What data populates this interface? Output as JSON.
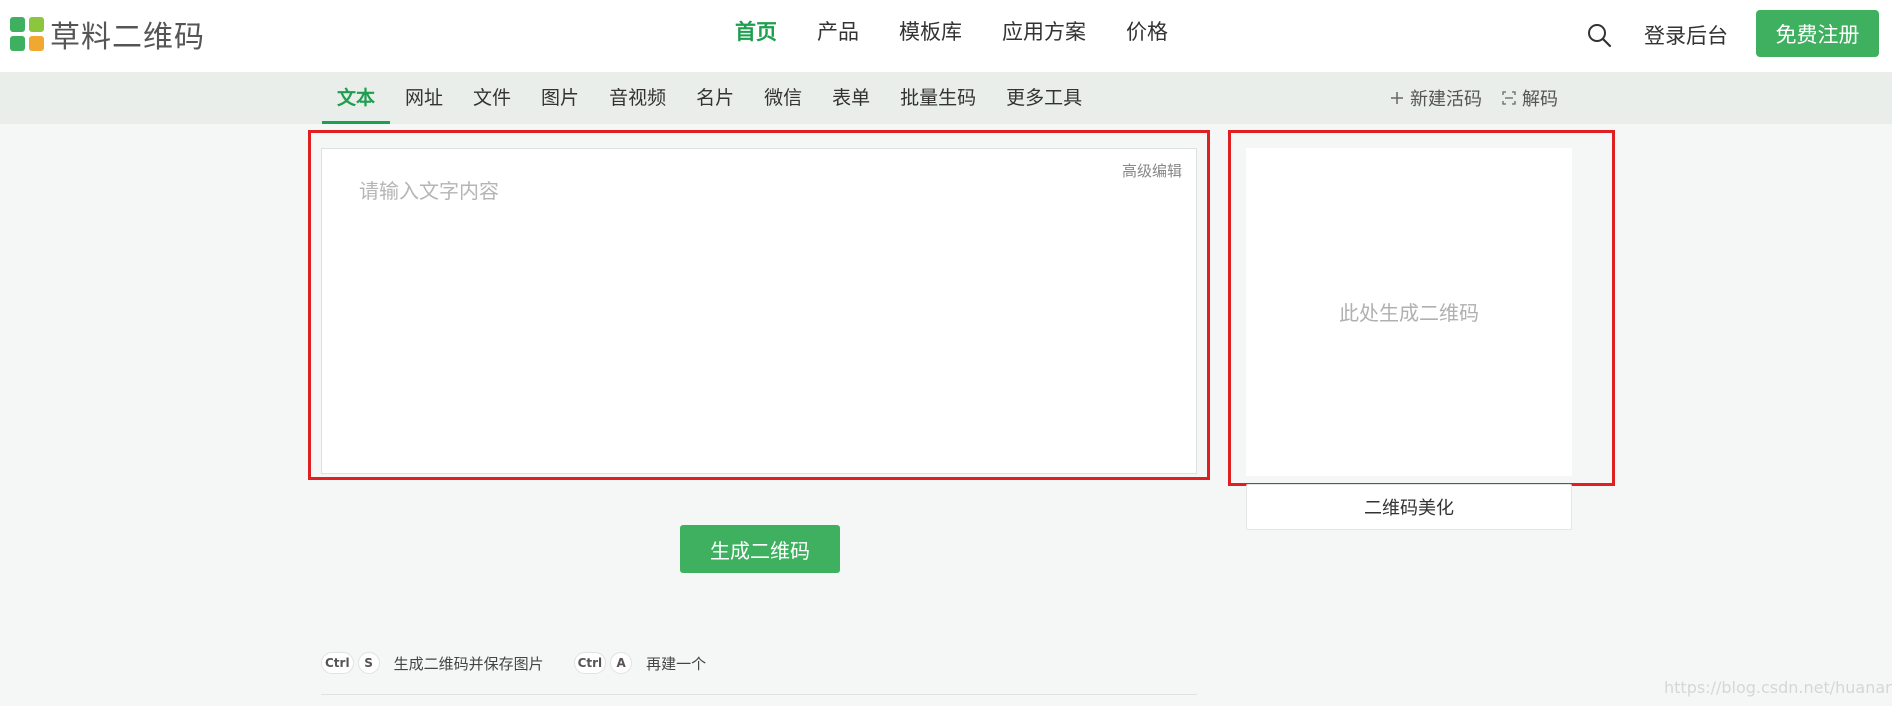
{
  "header": {
    "logo_text": "草料二维码",
    "nav": [
      {
        "label": "首页",
        "active": true
      },
      {
        "label": "产品",
        "active": false
      },
      {
        "label": "模板库",
        "active": false
      },
      {
        "label": "应用方案",
        "active": false
      },
      {
        "label": "价格",
        "active": false
      }
    ],
    "search_icon": "search-icon",
    "login_label": "登录后台",
    "register_label": "免费注册"
  },
  "subnav": {
    "tabs": [
      {
        "label": "文本",
        "active": true
      },
      {
        "label": "网址",
        "active": false
      },
      {
        "label": "文件",
        "active": false
      },
      {
        "label": "图片",
        "active": false
      },
      {
        "label": "音视频",
        "active": false
      },
      {
        "label": "名片",
        "active": false
      },
      {
        "label": "微信",
        "active": false
      },
      {
        "label": "表单",
        "active": false
      },
      {
        "label": "批量生码",
        "active": false
      },
      {
        "label": "更多工具",
        "active": false
      }
    ],
    "new_live_code_label": "新建活码",
    "decode_label": "解码"
  },
  "editor": {
    "placeholder": "请输入文字内容",
    "advanced_label": "高级编辑"
  },
  "qr_panel": {
    "placeholder_text": "此处生成二维码",
    "beautify_label": "二维码美化"
  },
  "generate_label": "生成二维码",
  "shortcuts": [
    {
      "keys": [
        "Ctrl",
        "S"
      ],
      "label": "生成二维码并保存图片"
    },
    {
      "keys": [
        "Ctrl",
        "A"
      ],
      "label": "再建一个"
    }
  ],
  "watermark": "https://blog.csdn.net/huanan__",
  "colors": {
    "accent": "#1e9e4f",
    "button_green": "#3eb05f",
    "highlight_red": "#e02020",
    "logo_colors": [
      "#3eb05f",
      "#8cc63f",
      "#3eb05f",
      "#f0a830"
    ]
  }
}
